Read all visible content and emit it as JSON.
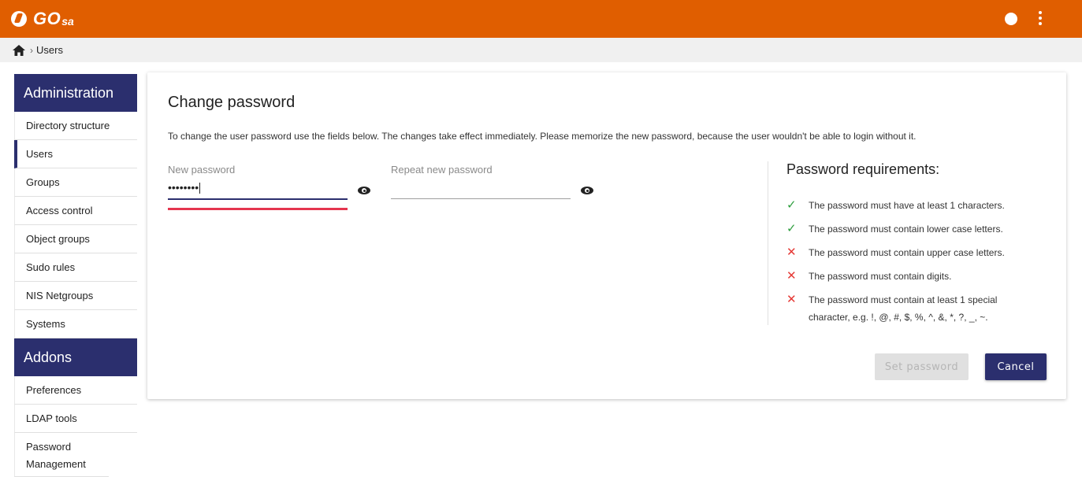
{
  "app": {
    "logo_main": "GO",
    "logo_sub": "sa"
  },
  "breadcrumb": {
    "current": "Users"
  },
  "sidebar": {
    "administration": {
      "heading": "Administration",
      "items": [
        "Directory structure",
        "Users",
        "Groups",
        "Access control",
        "Object groups",
        "Sudo rules",
        "NIS Netgroups",
        "Systems"
      ],
      "active_item": "Users"
    },
    "addons": {
      "heading": "Addons",
      "items": [
        "Preferences",
        "LDAP tools",
        "Password Management"
      ]
    }
  },
  "dialog": {
    "title": "Change password",
    "description": "To change the user password use the fields below. The changes take effect immediately. Please memorize the new password, because the user wouldn't be able to login without it.",
    "new_password": {
      "label": "New password",
      "value": "••••••••"
    },
    "repeat_password": {
      "label": "Repeat new password",
      "value": ""
    },
    "requirements": {
      "title": "Password requirements:",
      "items": [
        {
          "text": "The password must have at least 1 characters.",
          "status": "ok"
        },
        {
          "text": "The password must contain lower case letters.",
          "status": "ok"
        },
        {
          "text": "The password must contain upper case letters.",
          "status": "fail"
        },
        {
          "text": "The password must contain digits.",
          "status": "fail"
        },
        {
          "text": "The password must contain at least 1 special character, e.g. !, @, #, $, %, ^, &, *, ?, _, ~.",
          "status": "fail"
        }
      ]
    },
    "buttons": {
      "set_password": "Set password",
      "cancel": "Cancel"
    }
  },
  "icons": [
    "logo-icon",
    "user-avatar-icon",
    "more-vert-icon",
    "home-icon",
    "visibility-icon",
    "check-icon",
    "close-icon"
  ],
  "colors": {
    "header": "#e05e00",
    "nav": "#2b2f6e",
    "ok": "#2e9e3e",
    "fail": "#e53935",
    "error_underline": "#e5364f"
  }
}
